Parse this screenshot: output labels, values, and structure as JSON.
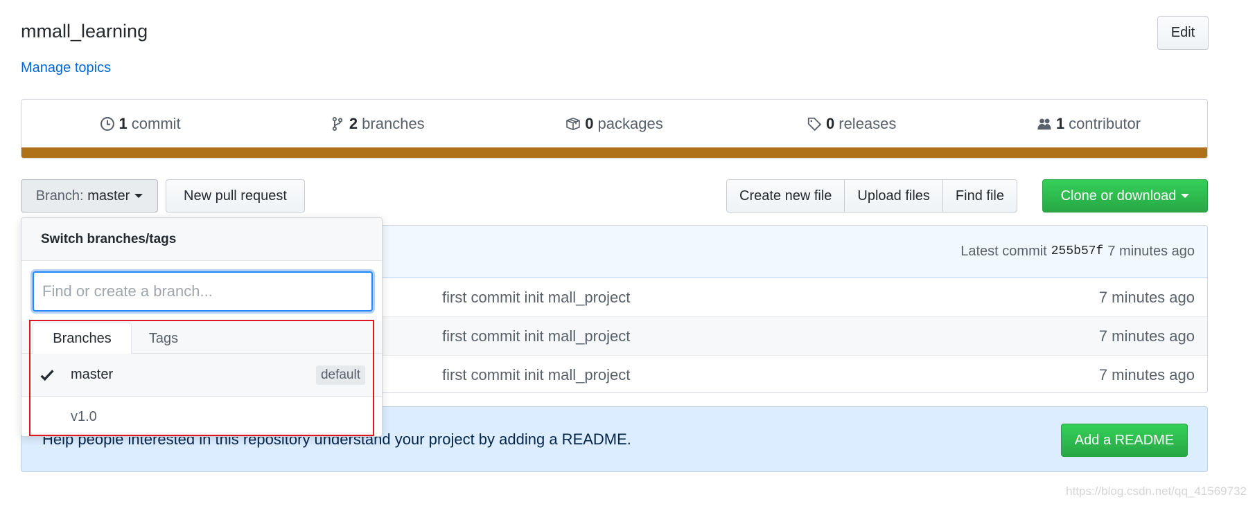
{
  "repo": {
    "title": "mmall_learning",
    "manage_topics": "Manage topics",
    "edit": "Edit"
  },
  "stats": {
    "items": [
      {
        "icon": "history-icon",
        "count": "1",
        "label": "commit"
      },
      {
        "icon": "git-branch-icon",
        "count": "2",
        "label": "branches"
      },
      {
        "icon": "package-icon",
        "count": "0",
        "label": "packages"
      },
      {
        "icon": "tag-icon",
        "count": "0",
        "label": "releases"
      },
      {
        "icon": "people-icon",
        "count": "1",
        "label": "contributor"
      }
    ],
    "language_color": "#b07219"
  },
  "toolbar": {
    "branch_prefix": "Branch:",
    "branch": "master",
    "new_pr": "New pull request",
    "create_file": "Create new file",
    "upload": "Upload files",
    "find": "Find file",
    "clone": "Clone or download"
  },
  "files": {
    "latest_prefix": "Latest commit",
    "sha": "255b57f",
    "latest_age": "7 minutes ago",
    "rows": [
      {
        "message": "first commit init mall_project",
        "age": "7 minutes ago"
      },
      {
        "message": "first commit init mall_project",
        "age": "7 minutes ago"
      },
      {
        "message": "first commit init mall_project",
        "age": "7 minutes ago"
      }
    ]
  },
  "readme": {
    "text": "Help people interested in this repository understand your project by adding a README.",
    "button": "Add a README"
  },
  "dropdown": {
    "title": "Switch branches/tags",
    "placeholder": "Find or create a branch...",
    "tabs": [
      "Branches",
      "Tags"
    ],
    "branches": [
      {
        "name": "master",
        "selected": true,
        "badge": "default"
      },
      {
        "name": "v1.0"
      }
    ]
  },
  "highlight_color": "#e0141e",
  "watermark": "https://blog.csdn.net/qq_41569732"
}
